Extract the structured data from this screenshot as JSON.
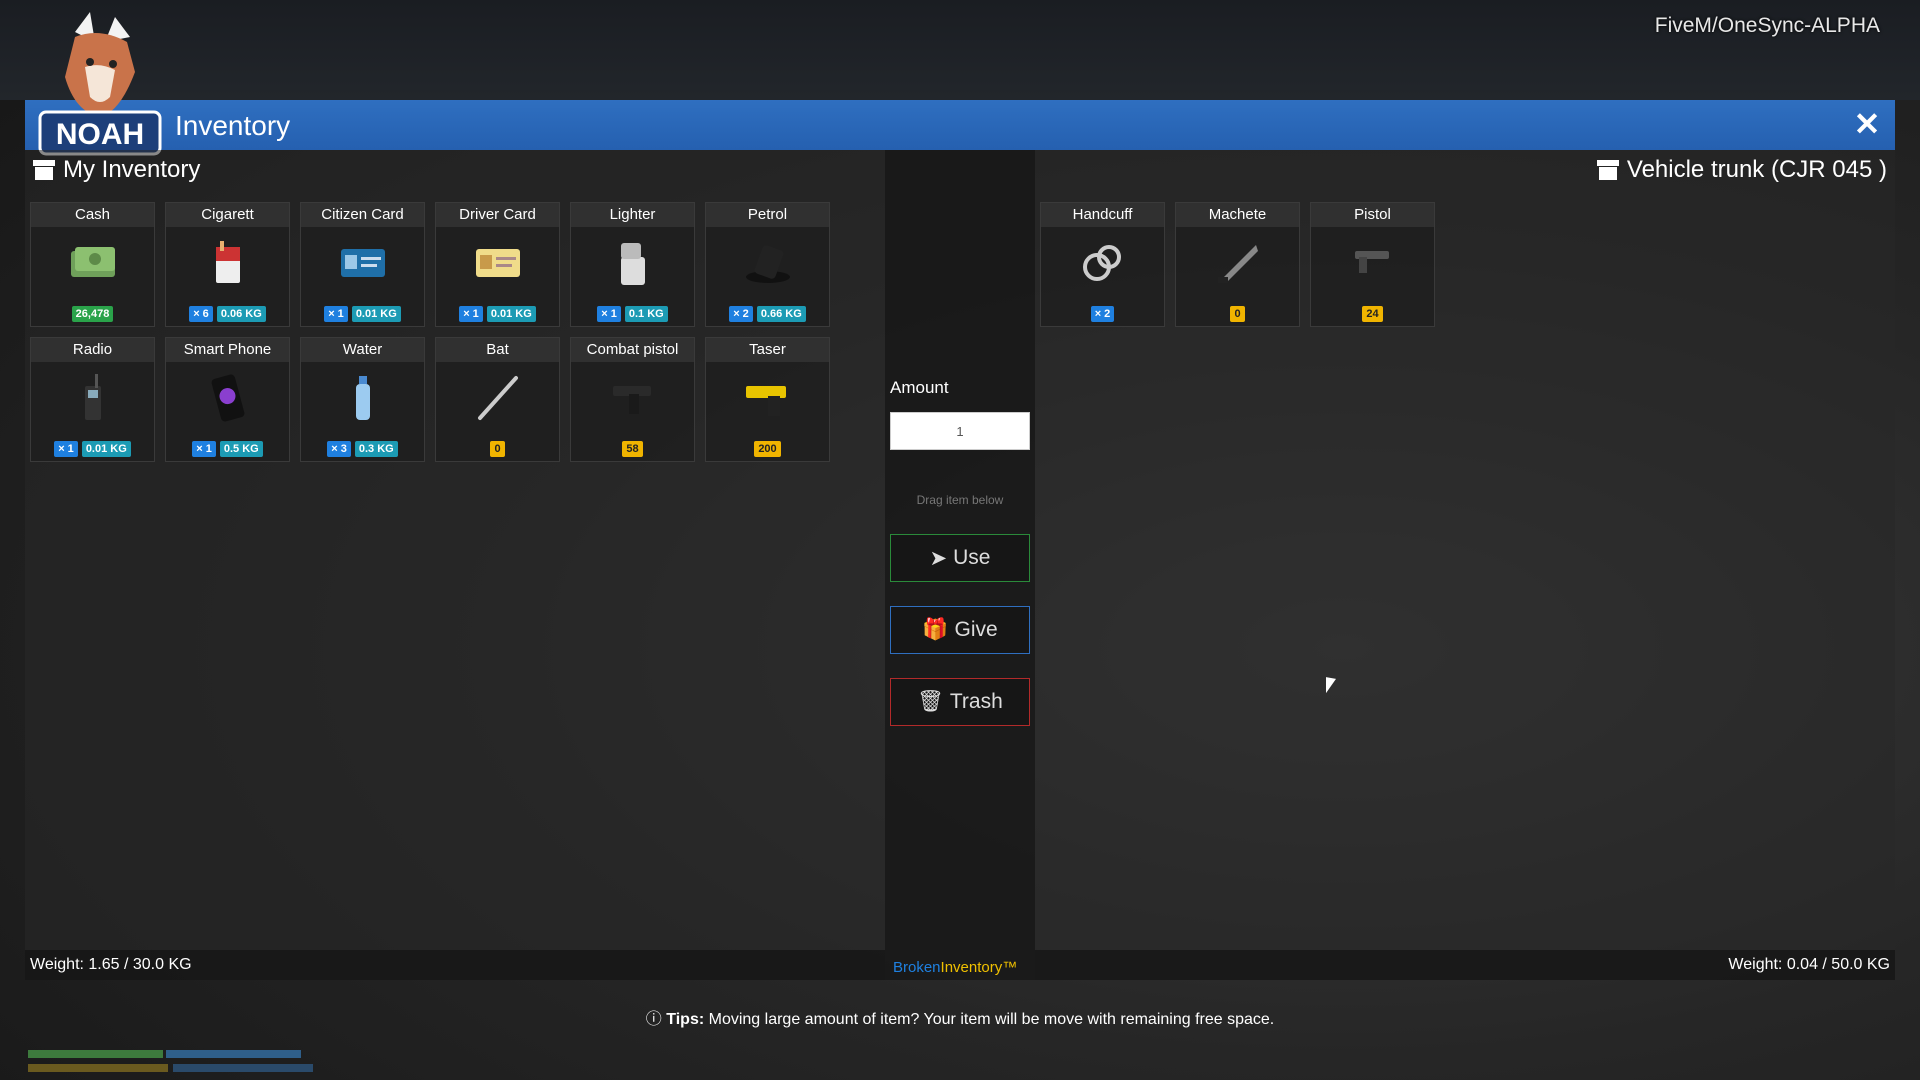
{
  "server_label": "FiveM/OneSync-ALPHA",
  "window": {
    "title": "Inventory",
    "close_icon": "close-icon"
  },
  "left": {
    "title": "My Inventory",
    "weight": "Weight: 1.65 / 30.0 KG",
    "items": [
      {
        "name": "Cash",
        "icon": "cash-icon",
        "badges": [
          {
            "text": "26,478",
            "style": "green"
          }
        ]
      },
      {
        "name": "Cigarett",
        "icon": "cigarette-icon",
        "badges": [
          {
            "text": "× 6",
            "style": "blue"
          },
          {
            "text": "0.06 KG",
            "style": "teal"
          }
        ]
      },
      {
        "name": "Citizen Card",
        "icon": "id-card-icon",
        "badges": [
          {
            "text": "× 1",
            "style": "blue"
          },
          {
            "text": "0.01 KG",
            "style": "teal"
          }
        ]
      },
      {
        "name": "Driver Card",
        "icon": "driver-card-icon",
        "badges": [
          {
            "text": "× 1",
            "style": "blue"
          },
          {
            "text": "0.01 KG",
            "style": "teal"
          }
        ]
      },
      {
        "name": "Lighter",
        "icon": "lighter-icon",
        "badges": [
          {
            "text": "× 1",
            "style": "blue"
          },
          {
            "text": "0.1 KG",
            "style": "teal"
          }
        ]
      },
      {
        "name": "Petrol",
        "icon": "petrol-icon",
        "badges": [
          {
            "text": "× 2",
            "style": "blue"
          },
          {
            "text": "0.66 KG",
            "style": "teal"
          }
        ]
      },
      {
        "name": "Radio",
        "icon": "radio-icon",
        "badges": [
          {
            "text": "× 1",
            "style": "blue"
          },
          {
            "text": "0.01 KG",
            "style": "teal"
          }
        ]
      },
      {
        "name": "Smart Phone",
        "icon": "phone-icon",
        "badges": [
          {
            "text": "× 1",
            "style": "blue"
          },
          {
            "text": "0.5 KG",
            "style": "teal"
          }
        ]
      },
      {
        "name": "Water",
        "icon": "water-bottle-icon",
        "badges": [
          {
            "text": "× 3",
            "style": "blue"
          },
          {
            "text": "0.3 KG",
            "style": "teal"
          }
        ]
      },
      {
        "name": "Bat",
        "icon": "bat-icon",
        "badges": [
          {
            "text": "0",
            "style": "yellow"
          }
        ]
      },
      {
        "name": "Combat pistol",
        "icon": "combat-pistol-icon",
        "badges": [
          {
            "text": "58",
            "style": "yellow"
          }
        ]
      },
      {
        "name": "Taser",
        "icon": "taser-icon",
        "badges": [
          {
            "text": "200",
            "style": "yellow"
          }
        ]
      }
    ]
  },
  "middle": {
    "amount_label": "Amount",
    "amount_value": "1",
    "drag_hint": "Drag item below",
    "use_label": "Use",
    "give_label": "Give",
    "trash_label": "Trash",
    "brand_a": "Broken",
    "brand_b": "Inventory™"
  },
  "right": {
    "title": "Vehicle trunk (CJR 045 )",
    "weight": "Weight: 0.04 / 50.0 KG",
    "items": [
      {
        "name": "Handcuff",
        "icon": "handcuff-icon",
        "badges": [
          {
            "text": "× 2",
            "style": "blue"
          }
        ]
      },
      {
        "name": "Machete",
        "icon": "machete-icon",
        "badges": [
          {
            "text": "0",
            "style": "yellow"
          }
        ]
      },
      {
        "name": "Pistol",
        "icon": "pistol-icon",
        "badges": [
          {
            "text": "24",
            "style": "yellow"
          }
        ]
      }
    ]
  },
  "tips": {
    "label": "Tips:",
    "text": "Moving large amount of item? Your item will be move with remaining free space."
  },
  "colors": {
    "titlebar": "#2f6fc0",
    "use_border": "#2a8a3a",
    "give_border": "#2f6fc0",
    "trash_border": "#b22a2a"
  }
}
